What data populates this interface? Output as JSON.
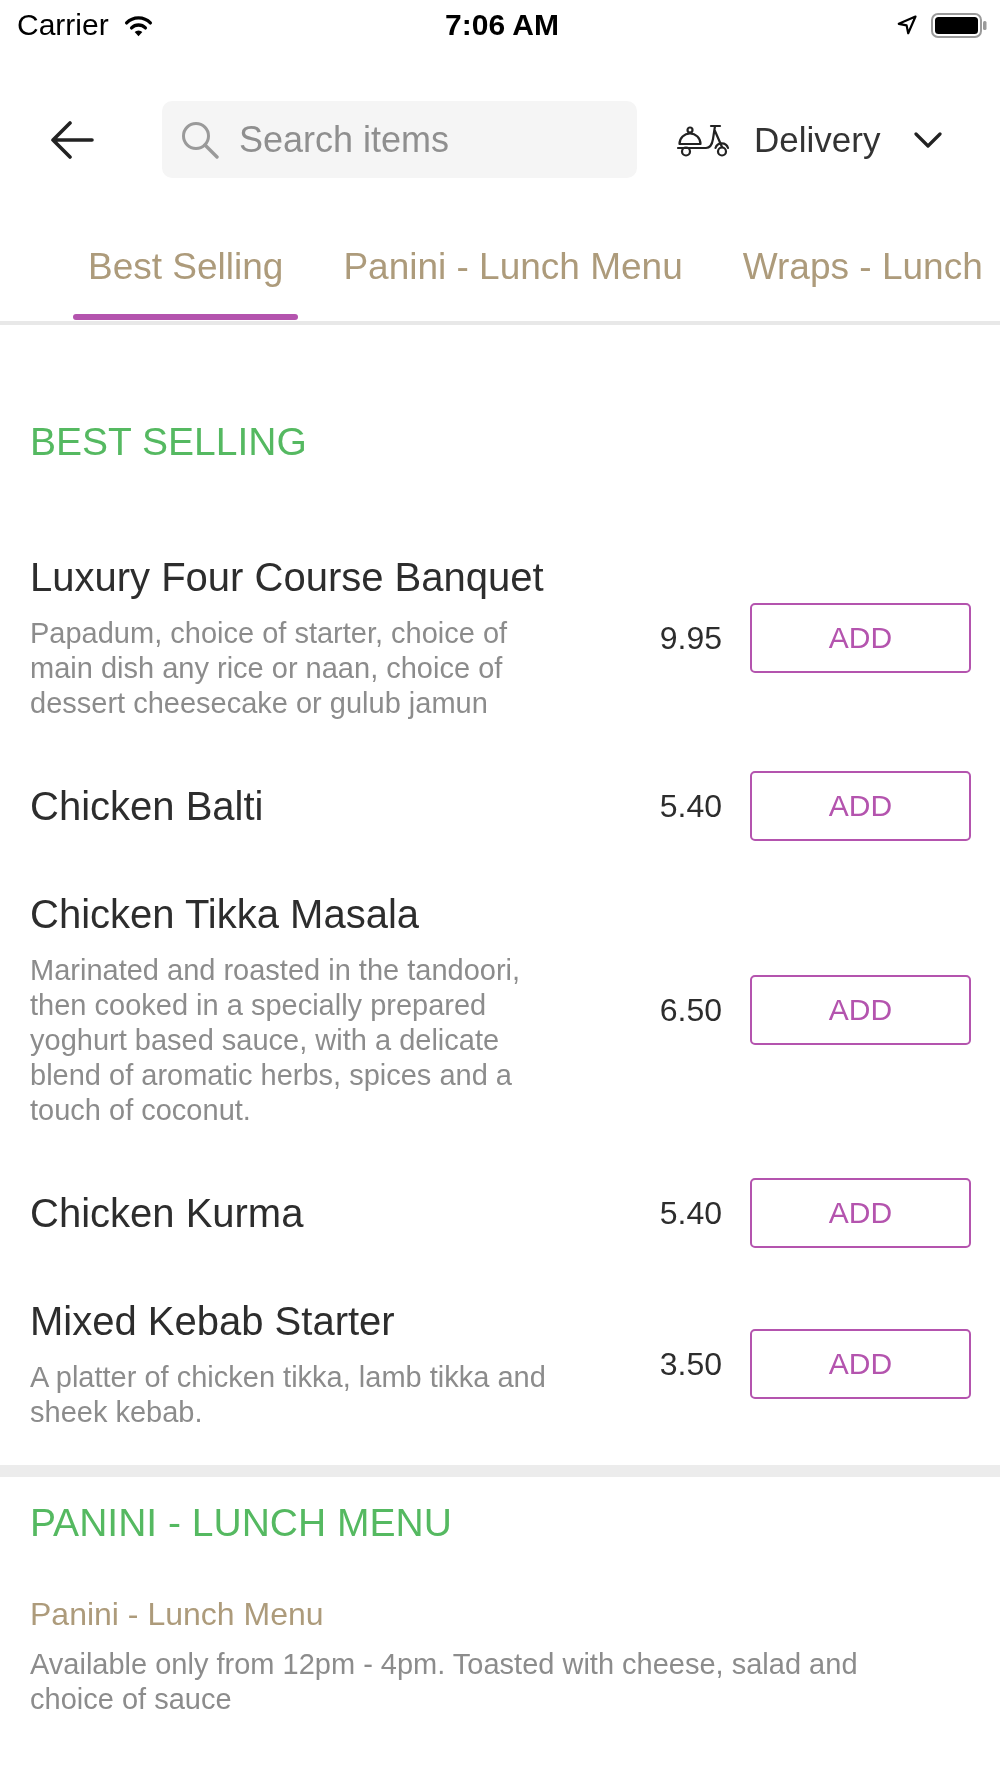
{
  "status_bar": {
    "carrier": "Carrier",
    "time": "7:06 AM"
  },
  "header": {
    "search": {
      "placeholder": "Search items"
    },
    "order_mode": {
      "label": "Delivery"
    }
  },
  "tabs": [
    {
      "label": "Best Selling",
      "selected": true
    },
    {
      "label": "Panini - Lunch Menu",
      "selected": false
    },
    {
      "label": "Wraps - Lunch",
      "selected": false
    }
  ],
  "sections": [
    {
      "title": "BEST SELLING",
      "items": [
        {
          "name": "Luxury Four Course Banquet",
          "description": "Papadum, choice of starter, choice of main dish any rice or naan, choice of dessert cheesecake or gulub jamun",
          "price": "9.95",
          "button_label": "ADD"
        },
        {
          "name": "Chicken Balti",
          "price": "5.40",
          "button_label": "ADD"
        },
        {
          "name": "Chicken Tikka Masala",
          "description": "Marinated and roasted in the tandoori, then cooked in a specially prepared yoghurt based sauce, with a delicate blend of aromatic herbs, spices and a touch of coconut.",
          "price": "6.50",
          "button_label": "ADD"
        },
        {
          "name": "Chicken Kurma",
          "price": "5.40",
          "button_label": "ADD"
        },
        {
          "name": "Mixed Kebab Starter",
          "description": "A platter of chicken tikka, lamb tikka and sheek kebab.",
          "price": "3.50",
          "button_label": "ADD"
        }
      ]
    },
    {
      "title": "PANINI - LUNCH MENU",
      "subtitle": "Panini - Lunch Menu",
      "note": "Available only from 12pm - 4pm. Toasted with cheese, salad and choice of sauce"
    }
  ]
}
